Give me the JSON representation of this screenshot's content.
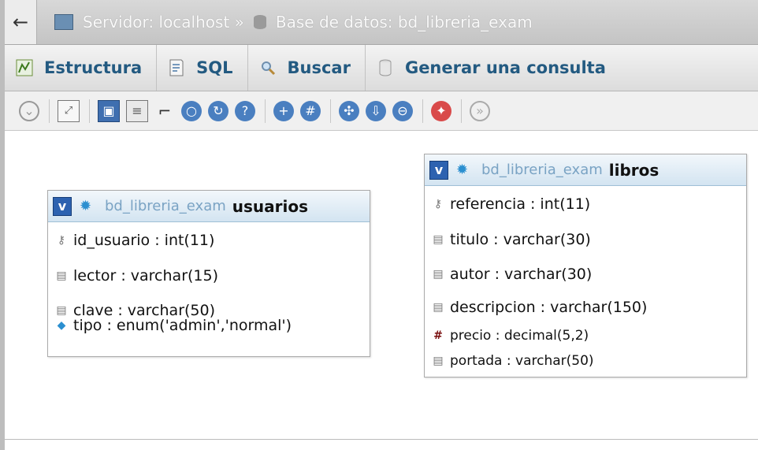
{
  "breadcrumb": {
    "back_glyph": "←",
    "server_text": "Servidor: localhost »",
    "db_text": "Base de datos: bd_libreria_exam"
  },
  "tabs": [
    {
      "label": "Estructura",
      "icon": "structure-icon"
    },
    {
      "label": "SQL",
      "icon": "sql-icon"
    },
    {
      "label": "Buscar",
      "icon": "search-icon"
    },
    {
      "label": "Generar una consulta",
      "icon": "query-icon"
    }
  ],
  "toolbar_icons": [
    "toggle-panel-icon",
    "fullscreen-icon",
    "save-icon",
    "list-icon",
    "relation-icon",
    "circle-icon",
    "reload-icon",
    "help-icon",
    "add-table-icon",
    "grid-icon",
    "move-icon",
    "export-icon",
    "pdf-icon",
    "angular-links-icon",
    "disable-icon"
  ],
  "colors": {
    "accent": "#235a81",
    "header_bg": "#d3e4f1",
    "badge": "#2d62b0"
  },
  "tables": {
    "usuarios": {
      "toggle": "v",
      "db": "bd_libreria_exam",
      "name": "usuarios",
      "columns": [
        {
          "icon": "key-icon",
          "text": "id_usuario : int(11)"
        },
        {
          "icon": "column-icon",
          "text": "lector : varchar(15)"
        },
        {
          "icon": "column-icon",
          "text": "clave : varchar(50)"
        },
        {
          "icon": "enum-icon",
          "text": "tipo : enum('admin','normal')"
        }
      ]
    },
    "libros": {
      "toggle": "v",
      "db": "bd_libreria_exam",
      "name": "libros",
      "columns": [
        {
          "icon": "key-icon",
          "text": "referencia : int(11)"
        },
        {
          "icon": "column-icon",
          "text": "titulo : varchar(30)"
        },
        {
          "icon": "column-icon",
          "text": "autor : varchar(30)"
        },
        {
          "icon": "column-icon",
          "text": "descripcion : varchar(150)"
        },
        {
          "icon": "numeric-icon",
          "text": "precio : decimal(5,2)"
        },
        {
          "icon": "column-icon",
          "text": "portada : varchar(50)"
        }
      ]
    }
  }
}
